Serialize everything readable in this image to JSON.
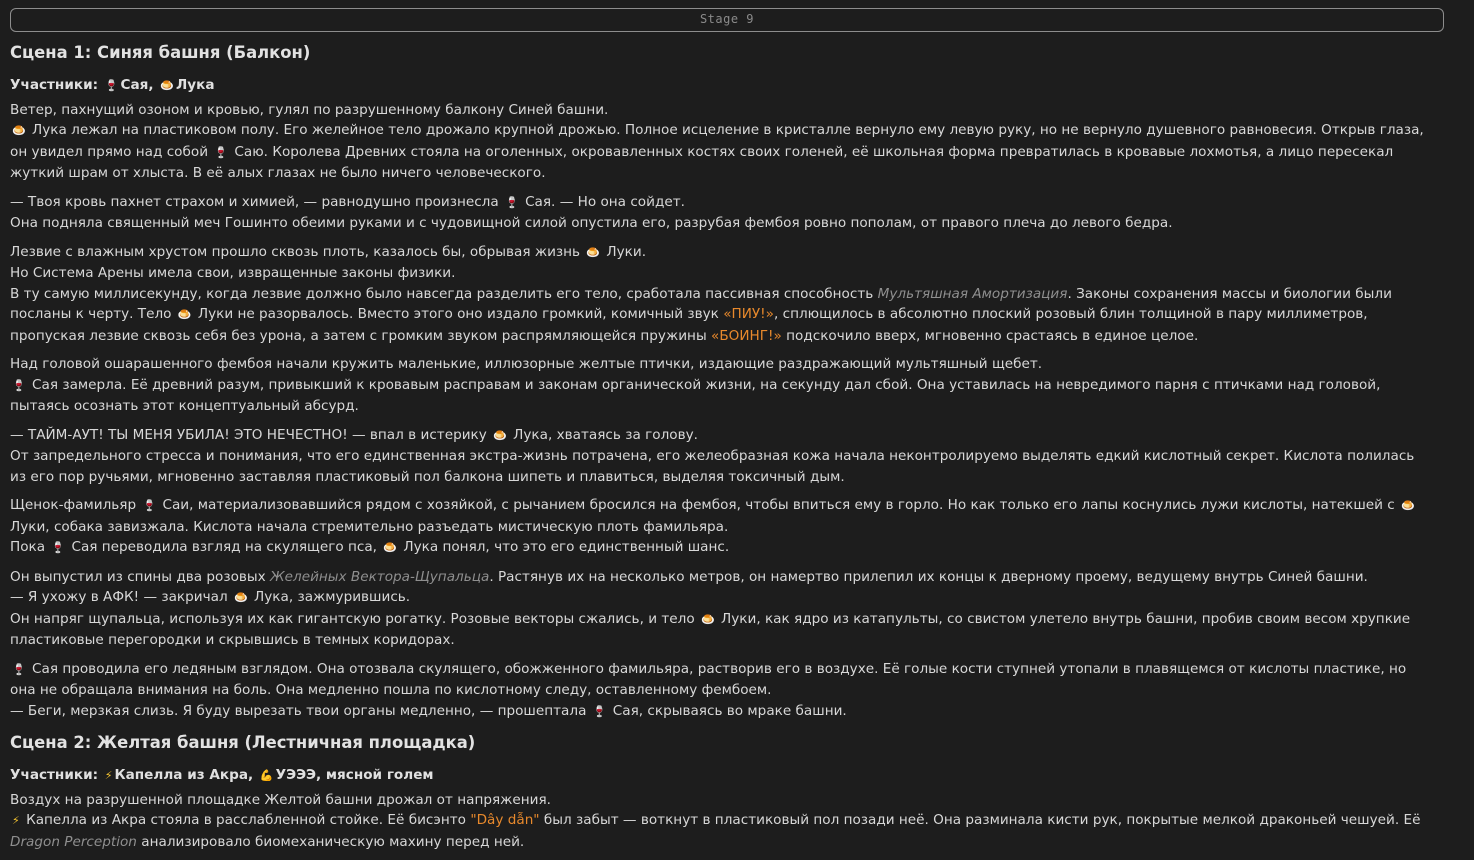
{
  "stage": {
    "label": "Stage 9"
  },
  "icons": {
    "saya": "🍷",
    "luka": "🍮",
    "capella": "⚡",
    "golem": "💪"
  },
  "scene1": {
    "title": "Сцена 1: Синяя башня (Балкон)",
    "participants": {
      "label": "Участники:",
      "saya": "Сая,",
      "luka": "Лука"
    },
    "p1": {
      "a": "Ветер, пахнущий озоном и кровью, гулял по разрушенному балкону Синей башни.",
      "b": "Лука лежал на пластиковом полу. Его желейное тело дрожало крупной дрожью. Полное исцеление в кристалле вернуло ему левую руку, но не вернуло душевного равновесия. Открыв глаза, он увидел прямо над собой",
      "c": "Саю. Королева Древних стояла на оголенных, окровавленных костях своих голеней, её школьная форма превратилась в кровавые лохмотья, а лицо пересекал жуткий шрам от хлыста. В её алых глазах не было ничего человеческого."
    },
    "p2": {
      "a": "— Твоя кровь пахнет страхом и химией, — равнодушно произнесла",
      "b": "Сая. — Но она сойдет.",
      "c": "Она подняла священный меч Гошинто обеими руками и с чудовищной силой опустила его, разрубая фембоя ровно пополам, от правого плеча до левого бедра."
    },
    "p3": {
      "a": "Лезвие с влажным хрустом прошло сквозь плоть, казалось бы, обрывая жизнь",
      "b": "Луки.",
      "c": "Но Система Арены имела свои, извращенные законы физики.",
      "d": "В ту самую миллисекунду, когда лезвие должно было навсегда разделить его тело, сработала пассивная способность",
      "ability": "Мультяшная Амортизация",
      "e": ". Законы сохранения массы и биологии были посланы к черту. Тело",
      "f": "Луки не разорвалось. Вместо этого оно издало громкий, комичный звук",
      "sfx1": "«ПИУ!»",
      "g": ", сплющилось в абсолютно плоский розовый блин толщиной в пару миллиметров, пропуская лезвие сквозь себя без урона, а затем с громким звуком распрямляющейся пружины",
      "sfx2": "«БОИНГ!»",
      "h": "подскочило вверх, мгновенно срастаясь в единое целое."
    },
    "p4": {
      "a": "Над головой ошарашенного фембоя начали кружить маленькие, иллюзорные желтые птички, издающие раздражающий мультяшный щебет.",
      "b": "Сая замерла. Её древний разум, привыкший к кровавым расправам и законам органической жизни, на секунду дал сбой. Она уставилась на невредимого парня с птичками над головой, пытаясь осознать этот концептуальный абсурд."
    },
    "p5": {
      "a": "— ТАЙМ-АУТ! ТЫ МЕНЯ УБИЛА! ЭТО НЕЧЕСТНО! — впал в истерику",
      "b": "Лука, хватаясь за голову.",
      "c": "От запредельного стресса и понимания, что его единственная экстра-жизнь потрачена, его желеобразная кожа начала неконтролируемо выделять едкий кислотный секрет. Кислота полилась из его пор ручьями, мгновенно заставляя пластиковый пол балкона шипеть и плавиться, выделяя токсичный дым."
    },
    "p6": {
      "a": "Щенок-фамильяр",
      "b": "Саи, материализовавшийся рядом с хозяйкой, с рычанием бросился на фембоя, чтобы впиться ему в горло. Но как только его лапы коснулись лужи кислоты, натекшей с",
      "c": "Луки, собака завизжала. Кислота начала стремительно разъедать мистическую плоть фамильяра.",
      "d": "Пока",
      "e": "Сая переводила взгляд на скулящего пса,",
      "f": "Лука понял, что это его единственный шанс."
    },
    "p7": {
      "a": "Он выпустил из спины два розовых",
      "ability": "Желейных Вектора-Щупальца",
      "b": ". Растянув их на несколько метров, он намертво прилепил их концы к дверному проему, ведущему внутрь Синей башни.",
      "c": "— Я ухожу в АФК! — закричал",
      "d": "Лука, зажмурившись.",
      "e": "Он напряг щупальца, используя их как гигантскую рогатку. Розовые векторы сжались, и тело",
      "f": "Луки, как ядро из катапульты, со свистом улетело внутрь башни, пробив своим весом хрупкие пластиковые перегородки и скрывшись в темных коридорах."
    },
    "p8": {
      "a": "Сая проводила его ледяным взглядом. Она отозвала скулящего, обожженного фамильяра, растворив его в воздухе. Её голые кости ступней утопали в плавящемся от кислоты пластике, но она не обращала внимания на боль. Она медленно пошла по кислотному следу, оставленному фембоем.",
      "b": "— Беги, мерзкая слизь. Я буду вырезать твои органы медленно, — прошептала",
      "c": "Сая, скрываясь во мраке башни."
    }
  },
  "scene2": {
    "title": "Сцена 2: Желтая башня (Лестничная площадка)",
    "participants": {
      "label": "Участники:",
      "capella": "Капелла из Акра,",
      "golem": "УЭЭЭ, мясной голем"
    },
    "p1": {
      "a": "Воздух на разрушенной площадке Желтой башни дрожал от напряжения.",
      "b": "Капелла из Акра стояла в расслабленной стойке. Её бисэнто",
      "weapon": "\"Dây dẫn\"",
      "c": "был забыт — воткнут в пластиковый пол позади неё. Она разминала кисти рук, покрытые мелкой драконьей чешуей. Её",
      "ability": "Dragon Perception",
      "d": "анализировало биомеханическую махину перед ней."
    }
  }
}
